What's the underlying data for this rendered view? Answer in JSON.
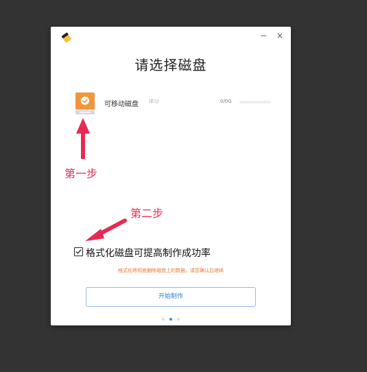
{
  "window": {
    "title": "请选择磁盘",
    "minimize_glyph": "−",
    "close_glyph": "×"
  },
  "disk": {
    "name": "可移动磁盘",
    "path": "(E:\\)",
    "size": "0/0G",
    "used_fraction": 0,
    "icon": "removable-disk-icon"
  },
  "format": {
    "checked": true,
    "label": "格式化磁盘可提高制作成功率",
    "warning": "格式化将彻底删除磁盘上的数据，请您确认后继续"
  },
  "start_button": {
    "label": "开始制作"
  },
  "pagination": {
    "count": 3,
    "active": 1
  },
  "annotations": {
    "step1": "第一步",
    "step2": "第二步"
  },
  "colors": {
    "background": "#333333",
    "accent": "#3d8bd8",
    "annotation": "#e82a52",
    "warning": "#e8743b",
    "disk_icon": "#f0963c"
  }
}
